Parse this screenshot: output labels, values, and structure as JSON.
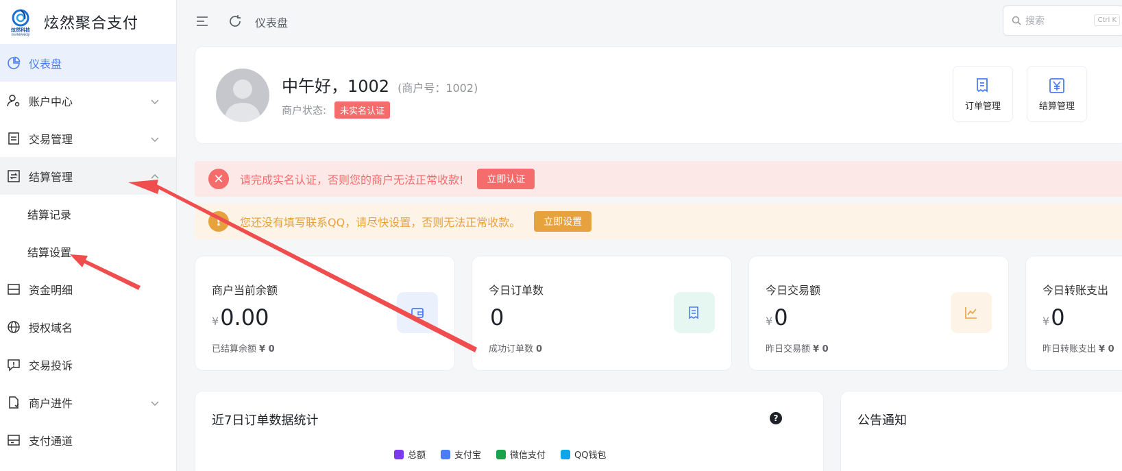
{
  "brand": {
    "title": "炫然聚合支付",
    "logo_cn": "炫然科技",
    "logo_en": "XUANRANKEJI"
  },
  "sidebar": {
    "items": [
      {
        "label": "仪表盘",
        "icon": "pie-chart-icon"
      },
      {
        "label": "账户中心",
        "icon": "user-settings-icon"
      },
      {
        "label": "交易管理",
        "icon": "document-icon"
      },
      {
        "label": "结算管理",
        "icon": "settlement-icon"
      },
      {
        "label": "资金明细",
        "icon": "wallet-icon"
      },
      {
        "label": "授权域名",
        "icon": "globe-icon"
      },
      {
        "label": "交易投诉",
        "icon": "complaint-icon"
      },
      {
        "label": "商户进件",
        "icon": "file-icon"
      },
      {
        "label": "支付通道",
        "icon": "channel-icon"
      }
    ],
    "sub_items": [
      {
        "label": "结算记录"
      },
      {
        "label": "结算设置"
      }
    ]
  },
  "topbar": {
    "breadcrumb": "仪表盘",
    "search_placeholder": "搜索",
    "shortcut": "Ctrl K"
  },
  "profile": {
    "greeting": "中午好，1002",
    "merchant_no": "(商户号：1002)",
    "status_label": "商户状态:",
    "status_badge": "未实名认证",
    "quick_links": [
      {
        "label": "订单管理",
        "icon": "order-icon"
      },
      {
        "label": "结算管理",
        "icon": "yen-icon"
      }
    ]
  },
  "alerts": {
    "error_text": "请完成实名认证，否则您的商户无法正常收款!",
    "error_button": "立即认证",
    "warn_text": "您还没有填写联系QQ，请尽快设置，否则无法正常收款。",
    "warn_button": "立即设置"
  },
  "stats": [
    {
      "title": "商户当前余额",
      "currency": "¥",
      "value": "0.00",
      "sub_label": "已结算余额",
      "sub_value": "¥ 0",
      "icon": "wallet-icon",
      "color": "#4c7cf3",
      "bg": "#eaf1fd"
    },
    {
      "title": "今日订单数",
      "currency": "",
      "value": "0",
      "sub_label": "成功订单数",
      "sub_value": "0",
      "icon": "order-icon",
      "color": "#4c7cf3",
      "bg": "#e6f7f2"
    },
    {
      "title": "今日交易额",
      "currency": "¥",
      "value": "0",
      "sub_label": "昨日交易额",
      "sub_value": "¥ 0",
      "icon": "trend-icon",
      "color": "#e6a23c",
      "bg": "#fdf3e7"
    },
    {
      "title": "今日转账支出",
      "currency": "¥",
      "value": "0",
      "sub_label": "昨日转账支出",
      "sub_value": "¥ 0",
      "icon": "transfer-icon",
      "color": "#4c7cf3",
      "bg": "#eaf1fd"
    }
  ],
  "chart_card": {
    "title": "近7日订单数据统计",
    "help": "?",
    "legend": [
      {
        "name": "总额",
        "color": "#7c3aed"
      },
      {
        "name": "支付宝",
        "color": "#4c7cf3"
      },
      {
        "name": "微信支付",
        "color": "#16a34a"
      },
      {
        "name": "QQ钱包",
        "color": "#0ea5e9"
      }
    ]
  },
  "notice_card": {
    "title": "公告通知"
  }
}
